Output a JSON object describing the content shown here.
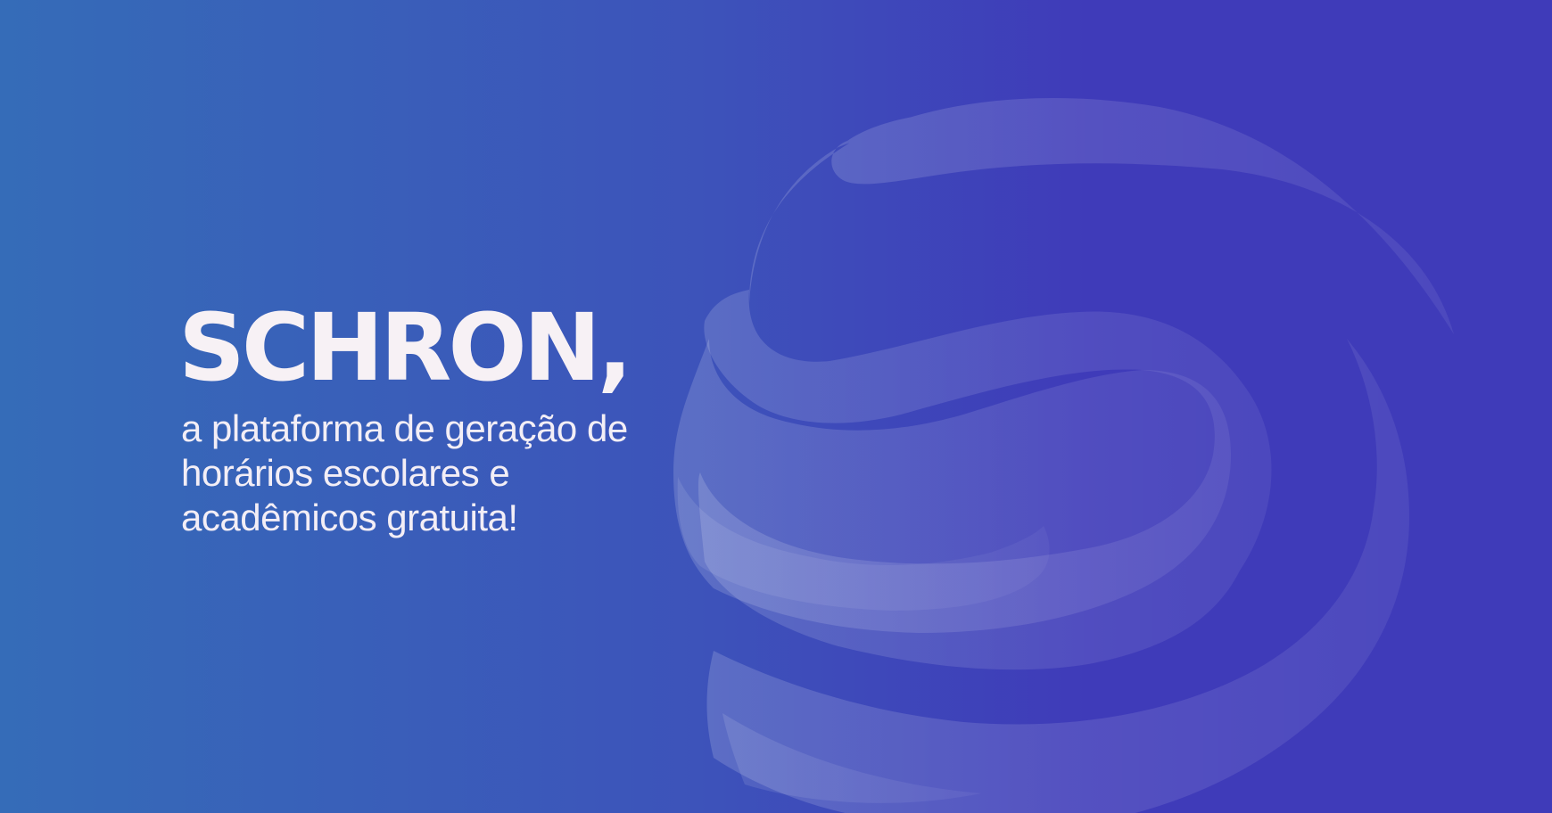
{
  "brand": {
    "name": "SCHRON,",
    "tagline_lines": [
      "a plataforma de geração de",
      "horários escolares e",
      "acadêmicos gratuita!"
    ]
  },
  "colors": {
    "background_left": "#356cb8",
    "background_right": "#3f3bb9",
    "text": "#f7f1f5",
    "logo_mark": "#ffffff"
  },
  "icons": {
    "logo_mark": "schron-s-logo-mark"
  }
}
